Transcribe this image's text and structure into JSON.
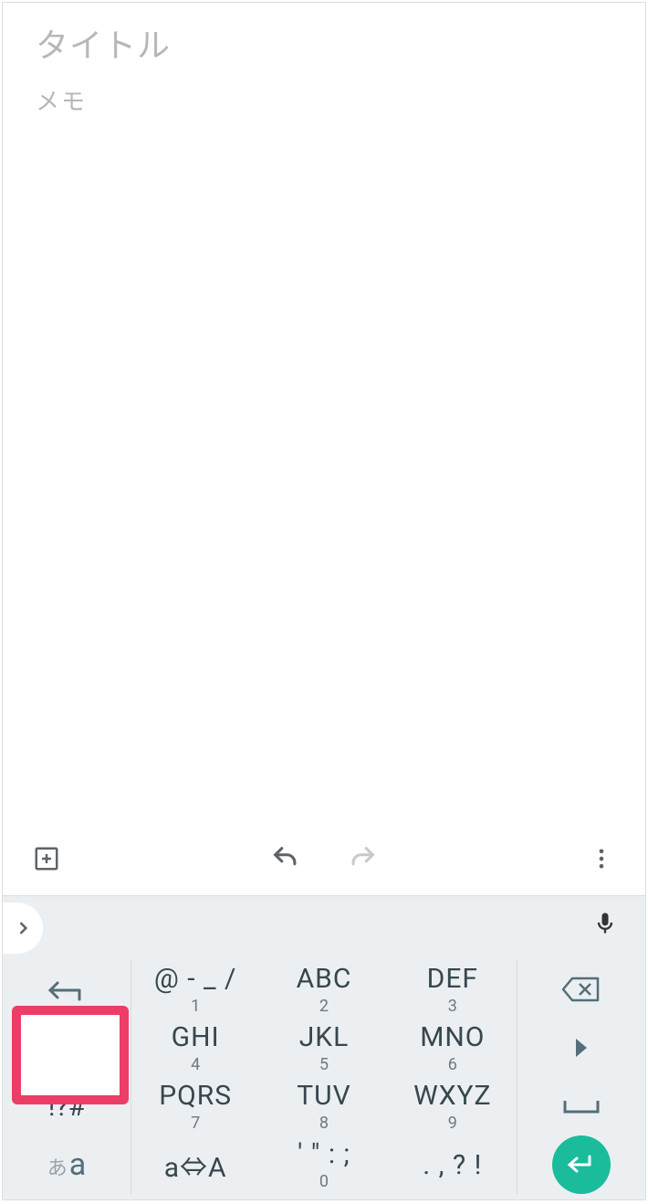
{
  "note": {
    "title_placeholder": "タイトル",
    "body_placeholder": "メモ",
    "title_value": "",
    "body_value": ""
  },
  "keyboard": {
    "rows": [
      [
        {
          "id": "reverse",
          "main": "",
          "sub": ""
        },
        {
          "id": "k1",
          "main": "@ - _ /",
          "sub": "1"
        },
        {
          "id": "k2",
          "main": "ABC",
          "sub": "2"
        },
        {
          "id": "k3",
          "main": "DEF",
          "sub": "3"
        },
        {
          "id": "bksp",
          "main": "",
          "sub": ""
        }
      ],
      [
        {
          "id": "left",
          "main": "",
          "sub": ""
        },
        {
          "id": "k4",
          "main": "GHI",
          "sub": "4"
        },
        {
          "id": "k5",
          "main": "JKL",
          "sub": "5"
        },
        {
          "id": "k6",
          "main": "MNO",
          "sub": "6"
        },
        {
          "id": "right",
          "main": "",
          "sub": ""
        }
      ],
      [
        {
          "id": "symbols",
          "main": "!?#",
          "sub": ""
        },
        {
          "id": "k7",
          "main": "PQRS",
          "sub": "7"
        },
        {
          "id": "k8",
          "main": "TUV",
          "sub": "8"
        },
        {
          "id": "k9",
          "main": "WXYZ",
          "sub": "9"
        },
        {
          "id": "space",
          "main": "",
          "sub": ""
        }
      ],
      [
        {
          "id": "mode",
          "main_jp": "あ",
          "main_en": "a",
          "sub": ""
        },
        {
          "id": "case",
          "main": "a⇔A",
          "sub": ""
        },
        {
          "id": "k0",
          "main": "' \" : ;",
          "sub": "0"
        },
        {
          "id": "punct",
          "main": ". , ? !",
          "sub": ""
        },
        {
          "id": "enter",
          "main": "",
          "sub": ""
        }
      ]
    ]
  }
}
